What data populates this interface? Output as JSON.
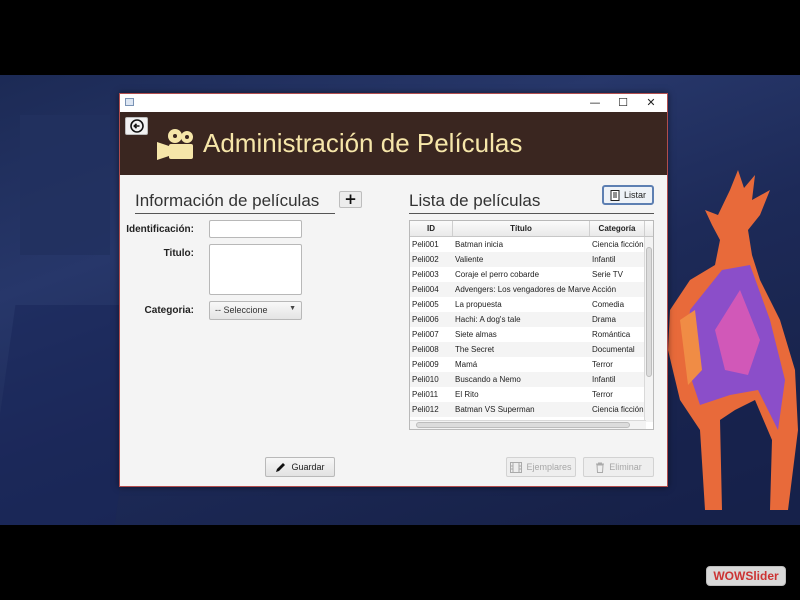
{
  "window": {
    "title": ""
  },
  "header": {
    "title": "Administración de Películas"
  },
  "form": {
    "section_title": "Información de películas",
    "identificacion_label": "Identificación:",
    "identificacion_value": "",
    "titulo_label": "Titulo:",
    "titulo_value": "",
    "categoria_label": "Categoria:",
    "categoria_selected": "-- Seleccione",
    "guardar_label": "Guardar"
  },
  "list": {
    "section_title": "Lista de películas",
    "listar_label": "Listar",
    "columns": [
      "ID",
      "Título",
      "Categoría"
    ],
    "rows": [
      [
        "Peli001",
        "Batman inicia",
        "Ciencia ficción"
      ],
      [
        "Peli002",
        "Valiente",
        "Infantil"
      ],
      [
        "Peli003",
        "Coraje el perro cobarde",
        "Serie TV"
      ],
      [
        "Peli004",
        "Advengers: Los vengadores de Marvel",
        "Acción"
      ],
      [
        "Peli005",
        "La propuesta",
        "Comedia"
      ],
      [
        "Peli006",
        "Hachi: A dog's tale",
        "Drama"
      ],
      [
        "Peli007",
        "Siete almas",
        "Romántica"
      ],
      [
        "Peli008",
        "The Secret",
        "Documental"
      ],
      [
        "Peli009",
        "Mamá",
        "Terror"
      ],
      [
        "Peli010",
        "Buscando a Nemo",
        "Infantil"
      ],
      [
        "Peli011",
        "El Rito",
        "Terror"
      ],
      [
        "Peli012",
        "Batman VS Superman",
        "Ciencia ficción"
      ]
    ],
    "ejemplares_label": "Ejemplares",
    "eliminar_label": "Eliminar"
  },
  "watermark": {
    "brand": "WOWSlider"
  },
  "colors": {
    "header_bg": "#3a2620",
    "header_title": "#f6e6a9",
    "window_border": "#b14d4d"
  }
}
